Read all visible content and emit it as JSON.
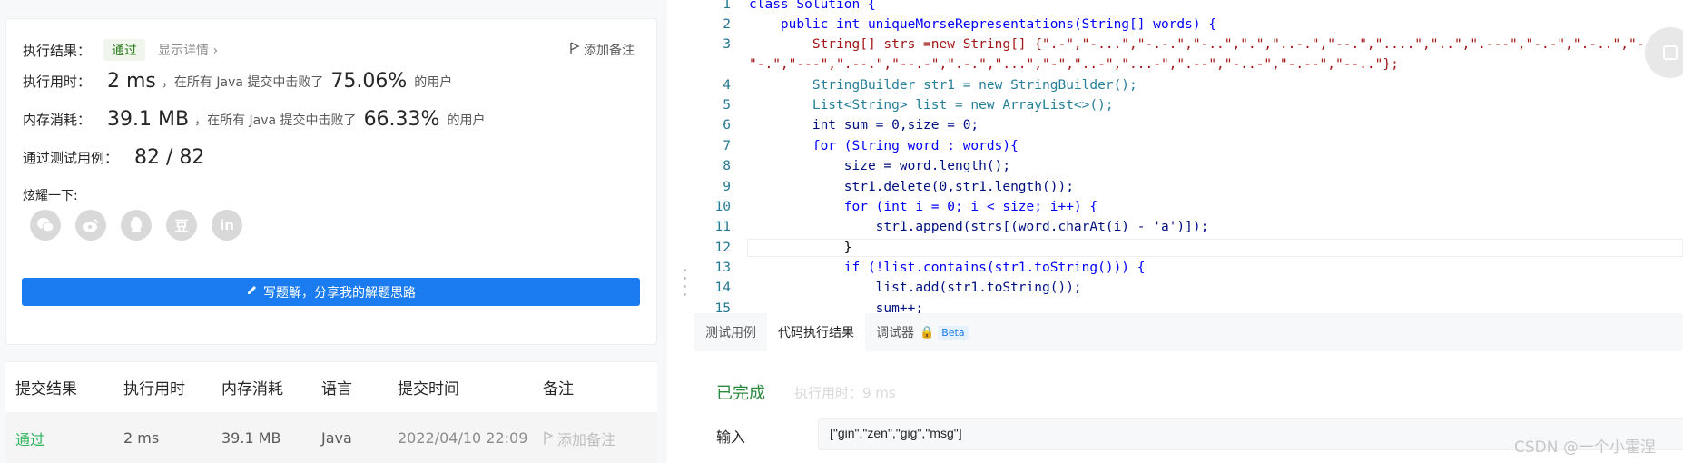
{
  "result": {
    "label": "执行结果：",
    "status": "通过",
    "detail_link": "显示详情 ›",
    "add_note": "添加备注"
  },
  "runtime": {
    "label": "执行用时：",
    "value": "2 ms",
    "text": "，在所有 Java 提交中击败了",
    "percent": "75.06%",
    "suffix": "的用户"
  },
  "memory": {
    "label": "内存消耗：",
    "value": "39.1 MB",
    "text": "，在所有 Java 提交中击败了",
    "percent": "66.33%",
    "suffix": "的用户"
  },
  "tests": {
    "label": "通过测试用例：",
    "value": "82 / 82"
  },
  "share": {
    "label": "炫耀一下:",
    "icons": [
      "wechat-icon",
      "weibo-icon",
      "qq-icon",
      "douban-icon",
      "linkedin-icon"
    ],
    "douban_glyph": "豆",
    "linkedin_glyph": "in"
  },
  "write_solution": "写题解，分享我的解题思路",
  "submissions": {
    "headers": [
      "提交结果",
      "执行用时",
      "内存消耗",
      "语言",
      "提交时间",
      "备注"
    ],
    "rows": [
      {
        "result": "通过",
        "time": "2 ms",
        "memory": "39.1 MB",
        "lang": "Java",
        "submitted": "2022/04/10 22:09",
        "note": "添加备注"
      }
    ]
  },
  "editor": {
    "line_numbers": [
      "1",
      "2",
      "3",
      "",
      "4",
      "5",
      "6",
      "7",
      "8",
      "9",
      "10",
      "11",
      "12",
      "13",
      "14",
      "15"
    ],
    "lines": [
      "class Solution {",
      "    public int uniqueMorseRepresentations(String[] words) {",
      "        String[] strs =new String[] {\".-\",\"-...\",\"-.-.\",\"-..\",\".\",\"..-.\",\"--.\",\"....\",\"..\",\".---\",\"-.-\",\".-..\",\"--\",",
      "\"-.\",\"---\",\".--.\",\"--.-\",\".-.\",\"...\",\"-\",\"..-\",\"...-\",\".--\",\"-..-\",\"-.--\",\"--..\"};",
      "        StringBuilder str1 = new StringBuilder();",
      "        List<String> list = new ArrayList<>();",
      "        int sum = 0,size = 0;",
      "        for (String word : words){",
      "            size = word.length();",
      "            str1.delete(0,str1.length());",
      "            for (int i = 0; i < size; i++) {",
      "                str1.append(strs[(word.charAt(i) - 'a')]);",
      "            }",
      "            if (!list.contains(str1.toString())) {",
      "                list.add(str1.toString());",
      "                sum++;"
    ]
  },
  "bottom_panel": {
    "tabs": [
      "测试用例",
      "代码执行结果",
      "调试器"
    ],
    "beta": "Beta",
    "done": "已完成",
    "runtime": "执行用时：9 ms",
    "input_label": "输入",
    "input_value": "[\"gin\",\"zen\",\"gig\",\"msg\"]"
  },
  "watermark": "CSDN @一个小霍涅"
}
